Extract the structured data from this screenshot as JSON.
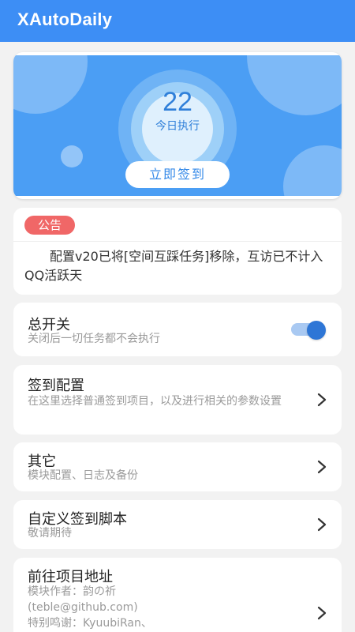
{
  "app": {
    "title": "XAutoDaily"
  },
  "hero": {
    "count": "22",
    "count_label": "今日执行",
    "checkin_label": "立即签到"
  },
  "notice": {
    "badge": "公告",
    "text": "配置v20已将[空间互踩任务]移除，互访已不计入QQ活跃天"
  },
  "master_switch": {
    "title": "总开关",
    "subtitle": "关闭后一切任务都不会执行",
    "enabled": true
  },
  "menu": [
    {
      "title": "签到配置",
      "subtitle": "在这里选择普通签到项目，以及进行相关的参数设置",
      "icon": "chevron-right-icon"
    },
    {
      "title": "其它",
      "subtitle": "模块配置、日志及备份",
      "icon": "chevron-right-icon"
    },
    {
      "title": "自定义签到脚本",
      "subtitle": "敬请期待",
      "icon": "chevron-right-icon"
    },
    {
      "title": "前往项目地址",
      "subtitle": "模块作者：韵の祈\n(teble@github.com)\n特别鸣谢：KyuubiRan、",
      "icon": "chevron-right-icon"
    }
  ],
  "colors": {
    "appbar": "#3d8ef5",
    "hero": "#4b9ef4",
    "badge": "#f06767",
    "switch": "#2e76d6"
  }
}
